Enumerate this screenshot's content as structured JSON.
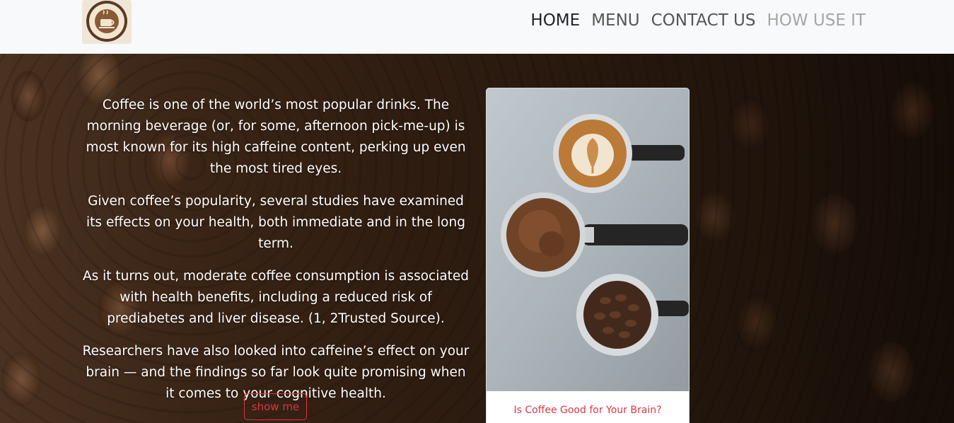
{
  "navbar": {
    "logo_alt": "coffee shop logo",
    "links": [
      {
        "label": "HOME",
        "state": "active"
      },
      {
        "label": "MENU",
        "state": "default"
      },
      {
        "label": "CONTACT US",
        "state": "default"
      },
      {
        "label": "HOW USE IT",
        "state": "muted"
      }
    ]
  },
  "hero": {
    "paragraphs": [
      "Coffee is one of the world’s most popular drinks. The morning beverage (or, for some, afternoon pick-me-up) is most known for its high caffeine content, perking up even the most tired eyes.",
      "Given coffee’s popularity, several studies have examined its effects on your health, both immediate and in the long term.",
      "As it turns out, moderate coffee consumption is associated with health benefits, including a reduced risk of prediabetes and liver disease. (1, 2Trusted Source).",
      "Researchers have also looked into caffeine’s effect on your brain — and the findings so far look quite promising when it comes to your cognitive health."
    ],
    "button_label": "show me"
  },
  "card": {
    "image_icon": "coffee-portafilters-image",
    "title": "Is Coffee Good for Your Brain?"
  },
  "colors": {
    "accent": "#dc3545",
    "navbar_bg": "#f8f9fa",
    "nav_active": "#212529",
    "nav_default": "#555555",
    "nav_muted": "#a6a6a6"
  }
}
